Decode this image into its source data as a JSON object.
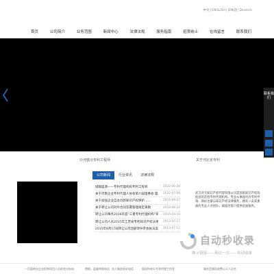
{
  "languages": [
    "中文",
    "ENGLISH",
    "日本語",
    "Deutsch"
  ],
  "nav": {
    "items": [
      "首页",
      "公司简介",
      "业务范围",
      "新闻中心",
      "法律法规",
      "服务指南",
      "招贤纳士",
      "在线留言",
      "联系我们"
    ]
  },
  "float_panel": {
    "text": "联系我们"
  },
  "sections": {
    "left_label": "沙河盛沅专利工程师",
    "right_label": "关于河北省专利"
  },
  "news": {
    "tabs": [
      "公司新闻",
      "行业资讯",
      "法律法规"
    ],
    "items": [
      {
        "title": "城陵盛源——专利代理机构专利工程师",
        "date": "2022-06-24"
      },
      {
        "title": "关于河南企业专利代理人协会第六届理事会 理事候选人名单",
        "date": "2022-07-08"
      },
      {
        "title": "关于加强企业自主创新知识产权保护……",
        "date": "2016-09-27"
      },
      {
        "title": "关于转让公司对外合同签署管理规定来稿",
        "date": "2018-08-22"
      },
      {
        "title": "转让公司事务2016年度“三重专利代理机构”荣誉",
        "date": "2016-09-19"
      },
      {
        "title": "转让公司人员2015年江苏省专利知识产权法律培训会议",
        "date": "2013-07-17"
      },
      {
        "title": "2015年6月17日转让公司团部领导参会执法案例发表会见AJ…",
        "date": "2013-07-12"
      }
    ]
  },
  "about": {
    "text": "武汉开元知识产权代理有限公司是国家知识产权局批准的首批专利代理机构，专业从事国内外专利申请、商标注册与知识产权法律服务，拥有一支高素质的专业人才团队，竭诚为客户提供优质服务。"
  },
  "watermark": {
    "title": "自动秒收录",
    "subtitle": "做上链接——来访一次——自动收录"
  },
  "footer": {
    "items": [
      "一页面转自企业招商项目人员综合分析站",
      "赞助，监督举报电话",
      "法人服务投诉电话",
      "版权所有©专利代理工作室",
      "服务范围及收费公示人员名"
    ]
  },
  "colors": {
    "accent": "#1f5ea8",
    "banner": "#000000",
    "float_panel": "#1e1e1e"
  }
}
